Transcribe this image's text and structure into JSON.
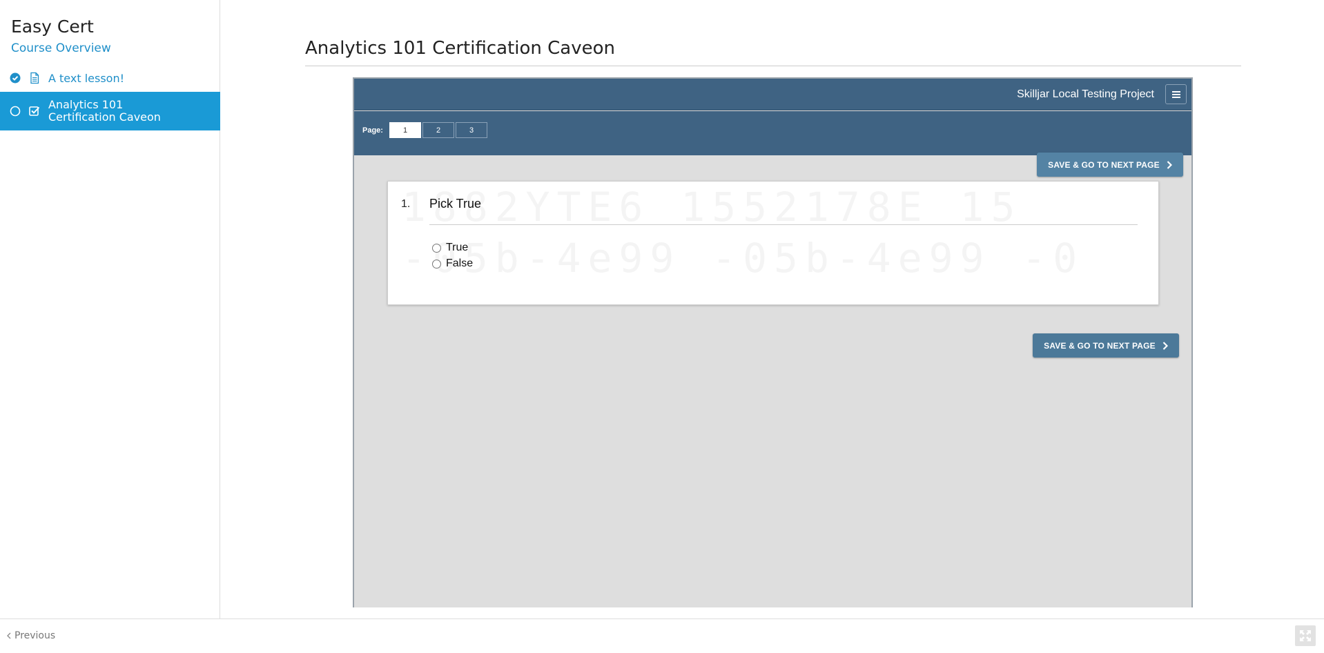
{
  "sidebar": {
    "course_title": "Easy Cert",
    "course_overview": "Course Overview",
    "lessons": [
      {
        "label": "A text lesson!",
        "status": "complete",
        "type": "text"
      },
      {
        "label": "Analytics 101 Certification Caveon",
        "status": "incomplete",
        "type": "quiz",
        "active": true
      }
    ]
  },
  "main": {
    "title": "Analytics 101 Certification Caveon",
    "exam": {
      "project_name": "Skilljar Local Testing Project",
      "page_label": "Page:",
      "pages": [
        "1",
        "2",
        "3"
      ],
      "current_page": "1",
      "next_button": "SAVE & GO TO NEXT PAGE",
      "watermark": [
        "1882YTE6  1552178E  15",
        "-05b-4e99 -05b-4e99 -0"
      ],
      "question": {
        "number": "1.",
        "text": "Pick True",
        "options": [
          "True",
          "False"
        ]
      }
    }
  },
  "footer": {
    "previous": "Previous"
  },
  "colors": {
    "accent": "#1a9ad6",
    "link": "#1f8fc9",
    "exam_header": "#3f6383",
    "button": "#4c7999",
    "exam_background": "#dedede"
  }
}
